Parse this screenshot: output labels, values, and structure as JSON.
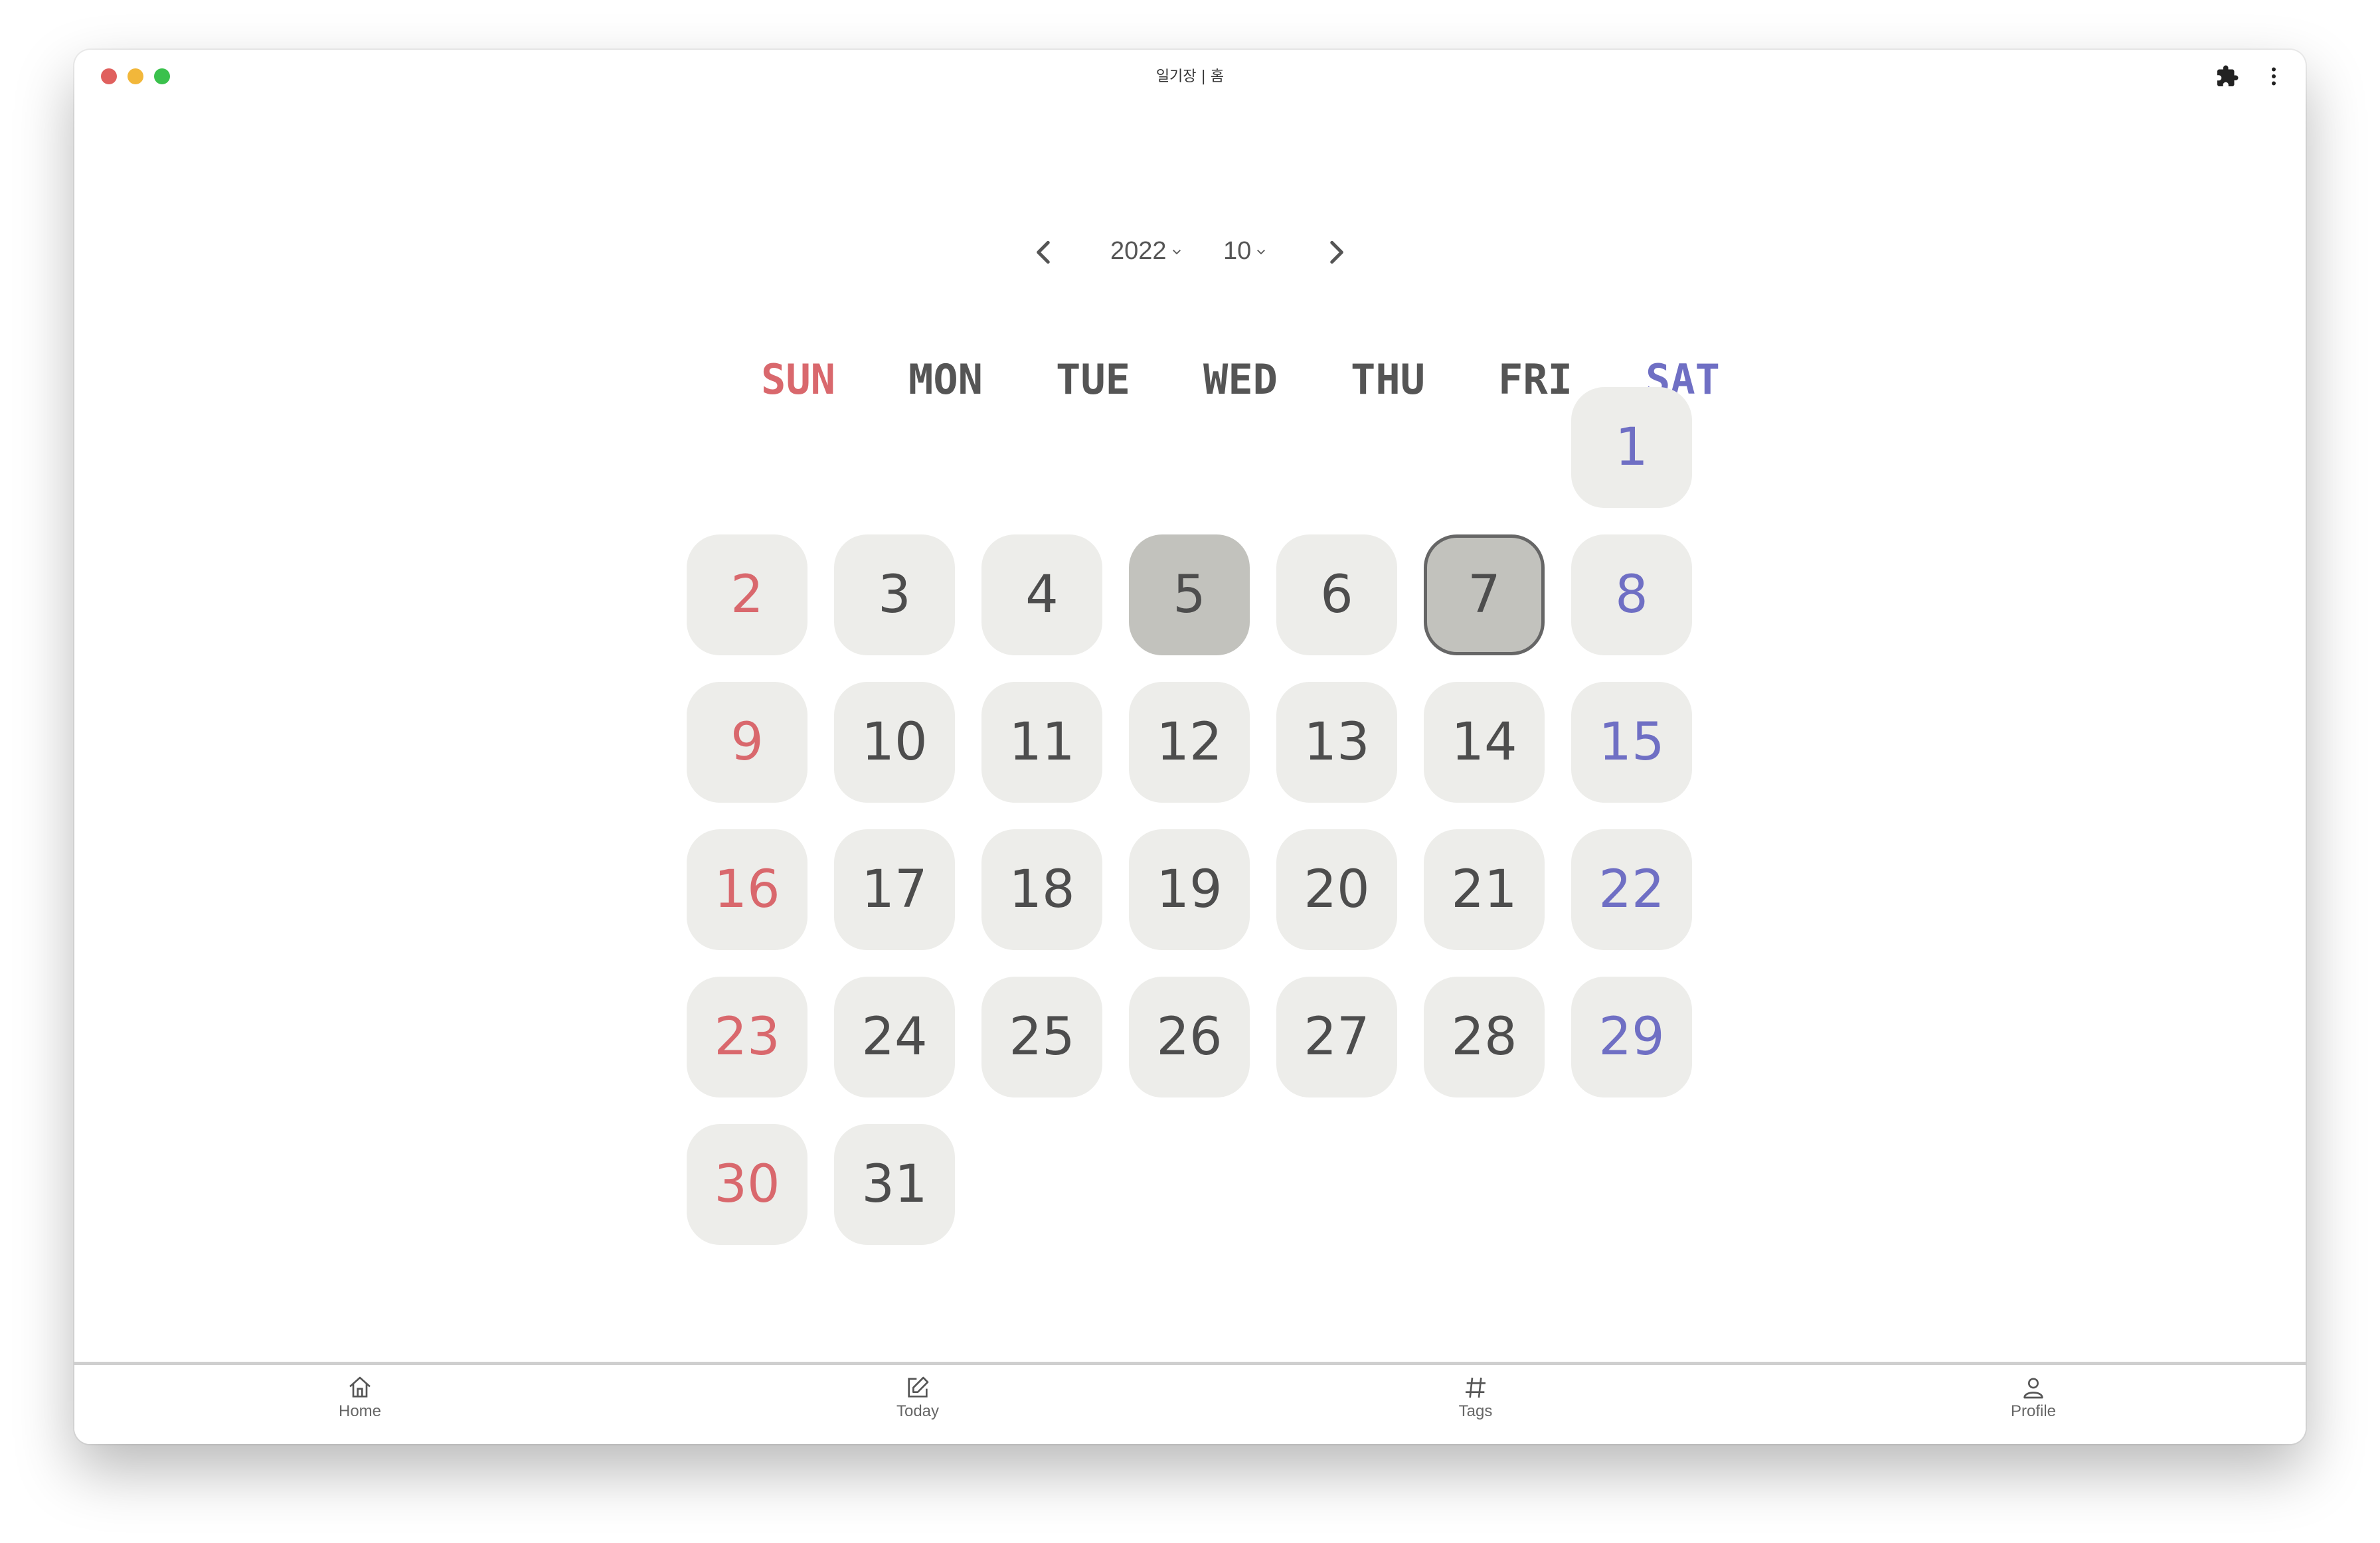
{
  "window": {
    "title": "일기장 | 홈",
    "traffic_colors": {
      "close": "#e0605e",
      "minimize": "#f2b73a",
      "maximize": "#3ac14c"
    },
    "extension_icon": "puzzle-icon",
    "menu_icon": "kebab-menu-icon"
  },
  "month_nav": {
    "prev_icon": "chevron-left-icon",
    "next_icon": "chevron-right-icon",
    "year": "2022",
    "month": "10"
  },
  "weekdays": [
    "SUN",
    "MON",
    "TUE",
    "WED",
    "THU",
    "FRI",
    "SAT"
  ],
  "colors": {
    "sunday": "#d9686d",
    "saturday": "#6f6fc4",
    "weekday": "#4d4d4d",
    "day_bg": "#ededea",
    "entry_bg": "#c2c2bd",
    "selected_border": "#666666"
  },
  "calendar": {
    "first_weekday_index": 6,
    "days": [
      "1",
      "2",
      "3",
      "4",
      "5",
      "6",
      "7",
      "8",
      "9",
      "10",
      "11",
      "12",
      "13",
      "14",
      "15",
      "16",
      "17",
      "18",
      "19",
      "20",
      "21",
      "22",
      "23",
      "24",
      "25",
      "26",
      "27",
      "28",
      "29",
      "30",
      "31"
    ],
    "days_with_entries": [
      "5",
      "7"
    ],
    "selected_day": "7"
  },
  "bottom_nav": {
    "tabs": [
      {
        "label": "Home",
        "icon": "home-icon"
      },
      {
        "label": "Today",
        "icon": "edit-icon"
      },
      {
        "label": "Tags",
        "icon": "hash-icon"
      },
      {
        "label": "Profile",
        "icon": "user-icon"
      }
    ]
  }
}
